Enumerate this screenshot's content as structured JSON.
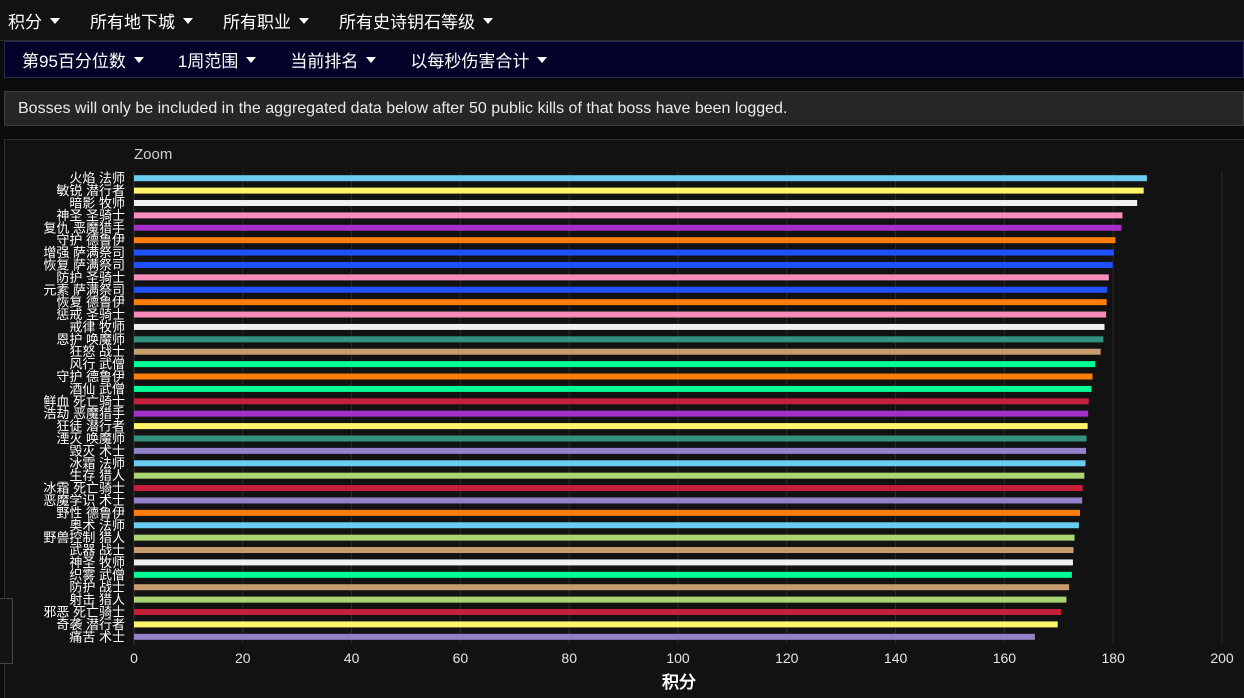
{
  "filters": {
    "row1": [
      "积分",
      "所有地下城",
      "所有职业",
      "所有史诗钥石等级"
    ],
    "row2": [
      "第95百分位数",
      "1周范围",
      "当前排名",
      "以每秒伤害合计"
    ]
  },
  "notice": "Bosses will only be included in the aggregated data below after 50 public kills of that boss have been logged.",
  "chart_data": {
    "type": "bar",
    "orientation": "horizontal",
    "zoom_label": "Zoom",
    "xlabel": "积分",
    "ylabel": "",
    "xlim": [
      0,
      200
    ],
    "xticks": [
      0,
      20,
      40,
      60,
      80,
      100,
      120,
      140,
      160,
      180,
      200
    ],
    "grid": true,
    "categories": [
      "火焰 法师",
      "敏锐 潜行者",
      "暗影 牧师",
      "神圣 圣骑士",
      "复仇 恶魔猎手",
      "守护 德鲁伊",
      "增强 萨满祭司",
      "恢复 萨满祭司",
      "防护 圣骑士",
      "元素 萨满祭司",
      "恢复 德鲁伊",
      "惩戒 圣骑士",
      "戒律 牧师",
      "恩护 唤魔师",
      "狂怒 战士",
      "风行 武僧",
      "守护 德鲁伊",
      "酒仙 武僧",
      "鲜血 死亡骑士",
      "浩劫 恶魔猎手",
      "狂徒 潜行者",
      "湮灭 唤魔师",
      "毁灭 术士",
      "冰霜 法师",
      "生存 猎人",
      "冰霜 死亡骑士",
      "恶魔学识 术士",
      "野性 德鲁伊",
      "奥术 法师",
      "野兽控制 猎人",
      "武器 战士",
      "神圣 牧师",
      "织雾 武僧",
      "防护 战士",
      "射击 猎人",
      "邪恶 死亡骑士",
      "奇袭 潜行者",
      "痛苦 术士"
    ],
    "values": [
      186.2,
      185.6,
      184.4,
      181.7,
      181.5,
      180.4,
      180.1,
      179.9,
      179.2,
      178.9,
      178.8,
      178.7,
      178.4,
      178.2,
      177.7,
      176.7,
      176.2,
      176.0,
      175.5,
      175.4,
      175.3,
      175.1,
      175.0,
      174.9,
      174.7,
      174.4,
      174.3,
      173.9,
      173.7,
      172.9,
      172.7,
      172.6,
      172.4,
      171.9,
      171.4,
      170.4,
      169.8,
      165.6
    ],
    "colors": [
      "#69ccf0",
      "#fff569",
      "#f0f0f0",
      "#f58cba",
      "#a330c9",
      "#ff7d0a",
      "#1f51ff",
      "#1f51ff",
      "#f58cba",
      "#1f51ff",
      "#ff7d0a",
      "#f58cba",
      "#f0f0f0",
      "#33937f",
      "#c79c6e",
      "#00ff96",
      "#ff7d0a",
      "#00ff96",
      "#c41f3b",
      "#a330c9",
      "#fff569",
      "#33937f",
      "#9482c9",
      "#69ccf0",
      "#abd473",
      "#c41f3b",
      "#9482c9",
      "#ff7d0a",
      "#69ccf0",
      "#abd473",
      "#c79c6e",
      "#f0f0f0",
      "#00ff96",
      "#c79c6e",
      "#abd473",
      "#c41f3b",
      "#fff569",
      "#9482c9"
    ]
  }
}
